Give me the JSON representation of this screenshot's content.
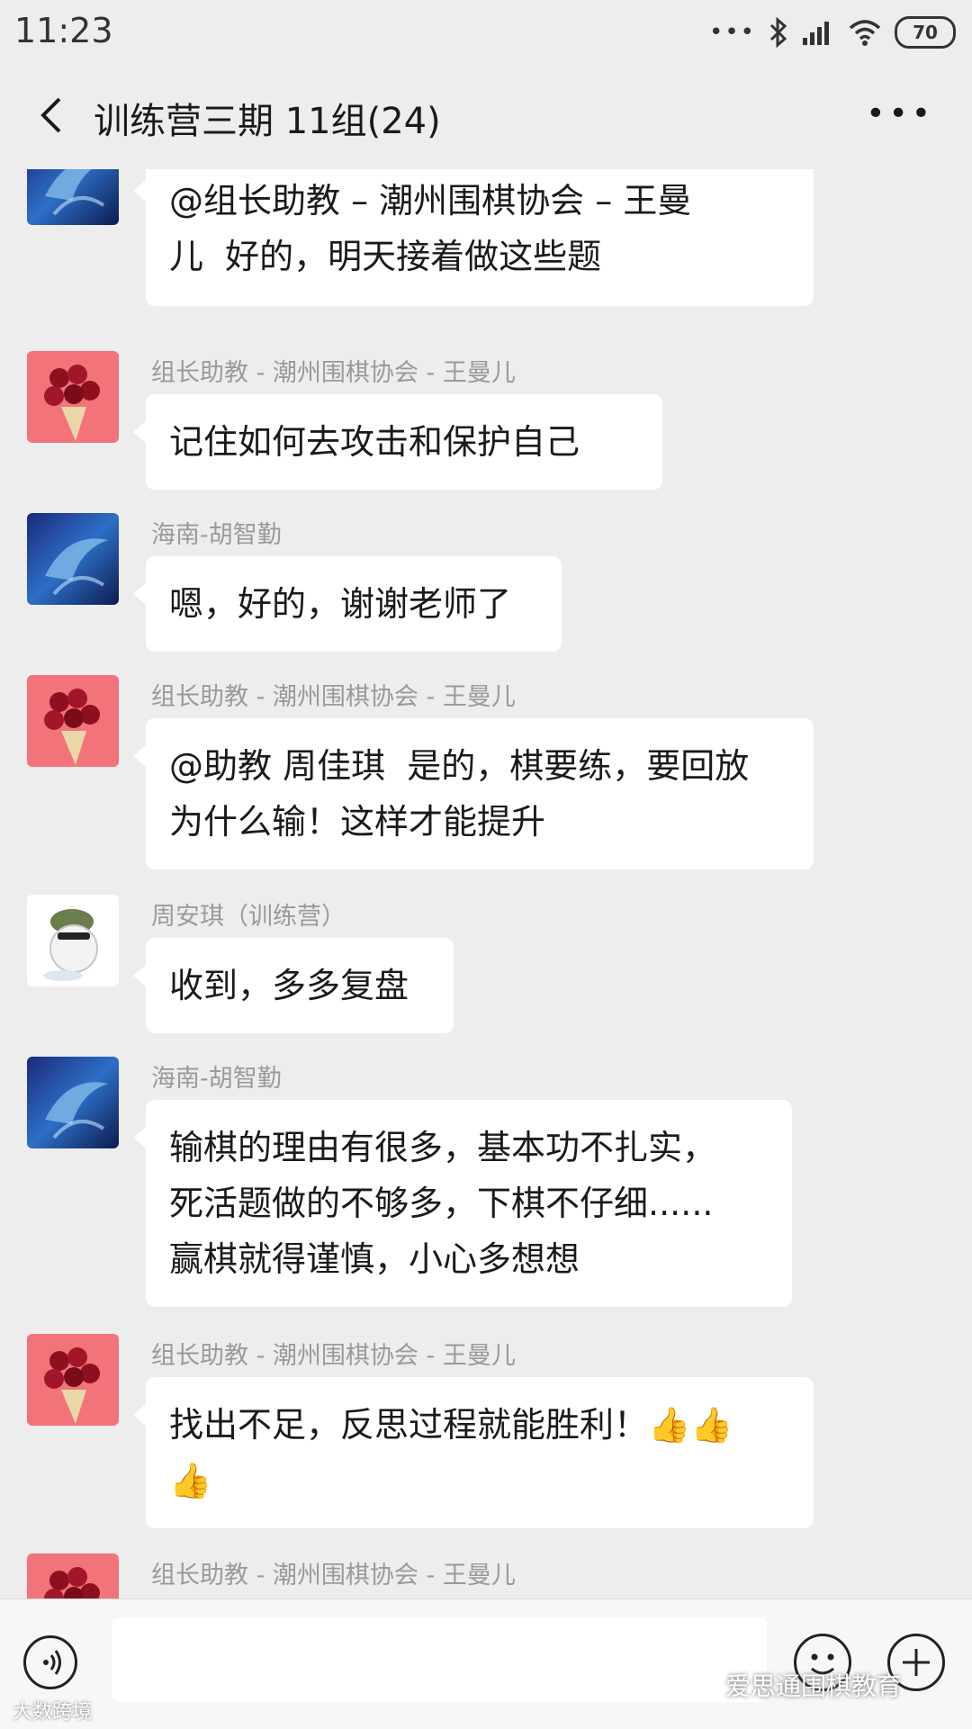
{
  "status_bar": {
    "time": "11:23",
    "signal_dots": "•••",
    "battery": "70"
  },
  "header": {
    "title": "训练营三期 11组(24)"
  },
  "icons": {
    "back": "chevron-left-icon",
    "more": "more-icon",
    "voice": "voice-icon",
    "emoji": "emoji-icon",
    "plus": "plus-icon",
    "bluetooth": "bluetooth-icon",
    "signal": "signal-icon",
    "wifi": "wifi-icon"
  },
  "colors": {
    "background": "#ededed",
    "bubble": "#ffffff",
    "sender_text": "#9a9a9a"
  },
  "messages": [
    {
      "sender": "",
      "avatar": "dolphin",
      "text": "@组长助教 – 潮州围棋协会 – 王曼\n儿  好的，明天接着做这些题"
    },
    {
      "sender": "组长助教 - 潮州围棋协会 - 王曼儿",
      "avatar": "rose",
      "text": "记住如何去攻击和保护自己"
    },
    {
      "sender": "海南-胡智勤",
      "avatar": "dolphin",
      "text": "嗯，好的，谢谢老师了"
    },
    {
      "sender": "组长助教 - 潮州围棋协会 - 王曼儿",
      "avatar": "rose",
      "text": "@助教 周佳琪  是的，棋要练，要回放\n为什么输！这样才能提升"
    },
    {
      "sender": "周安琪（训练营）",
      "avatar": "cat",
      "text": "收到，多多复盘"
    },
    {
      "sender": "海南-胡智勤",
      "avatar": "dolphin",
      "text": "输棋的理由有很多，基本功不扎实，\n死活题做的不够多，下棋不仔细......\n赢棋就得谨慎，小心多想想"
    },
    {
      "sender": "组长助教 - 潮州围棋协会 - 王曼儿",
      "avatar": "rose",
      "text": "找出不足，反思过程就能胜利！👍👍\n👍"
    },
    {
      "sender": "组长助教 - 潮州围棋协会 - 王曼儿",
      "avatar": "rose",
      "text": ""
    }
  ],
  "watermarks": {
    "left": "大数跨境",
    "right": "爱思通围棋教育"
  }
}
